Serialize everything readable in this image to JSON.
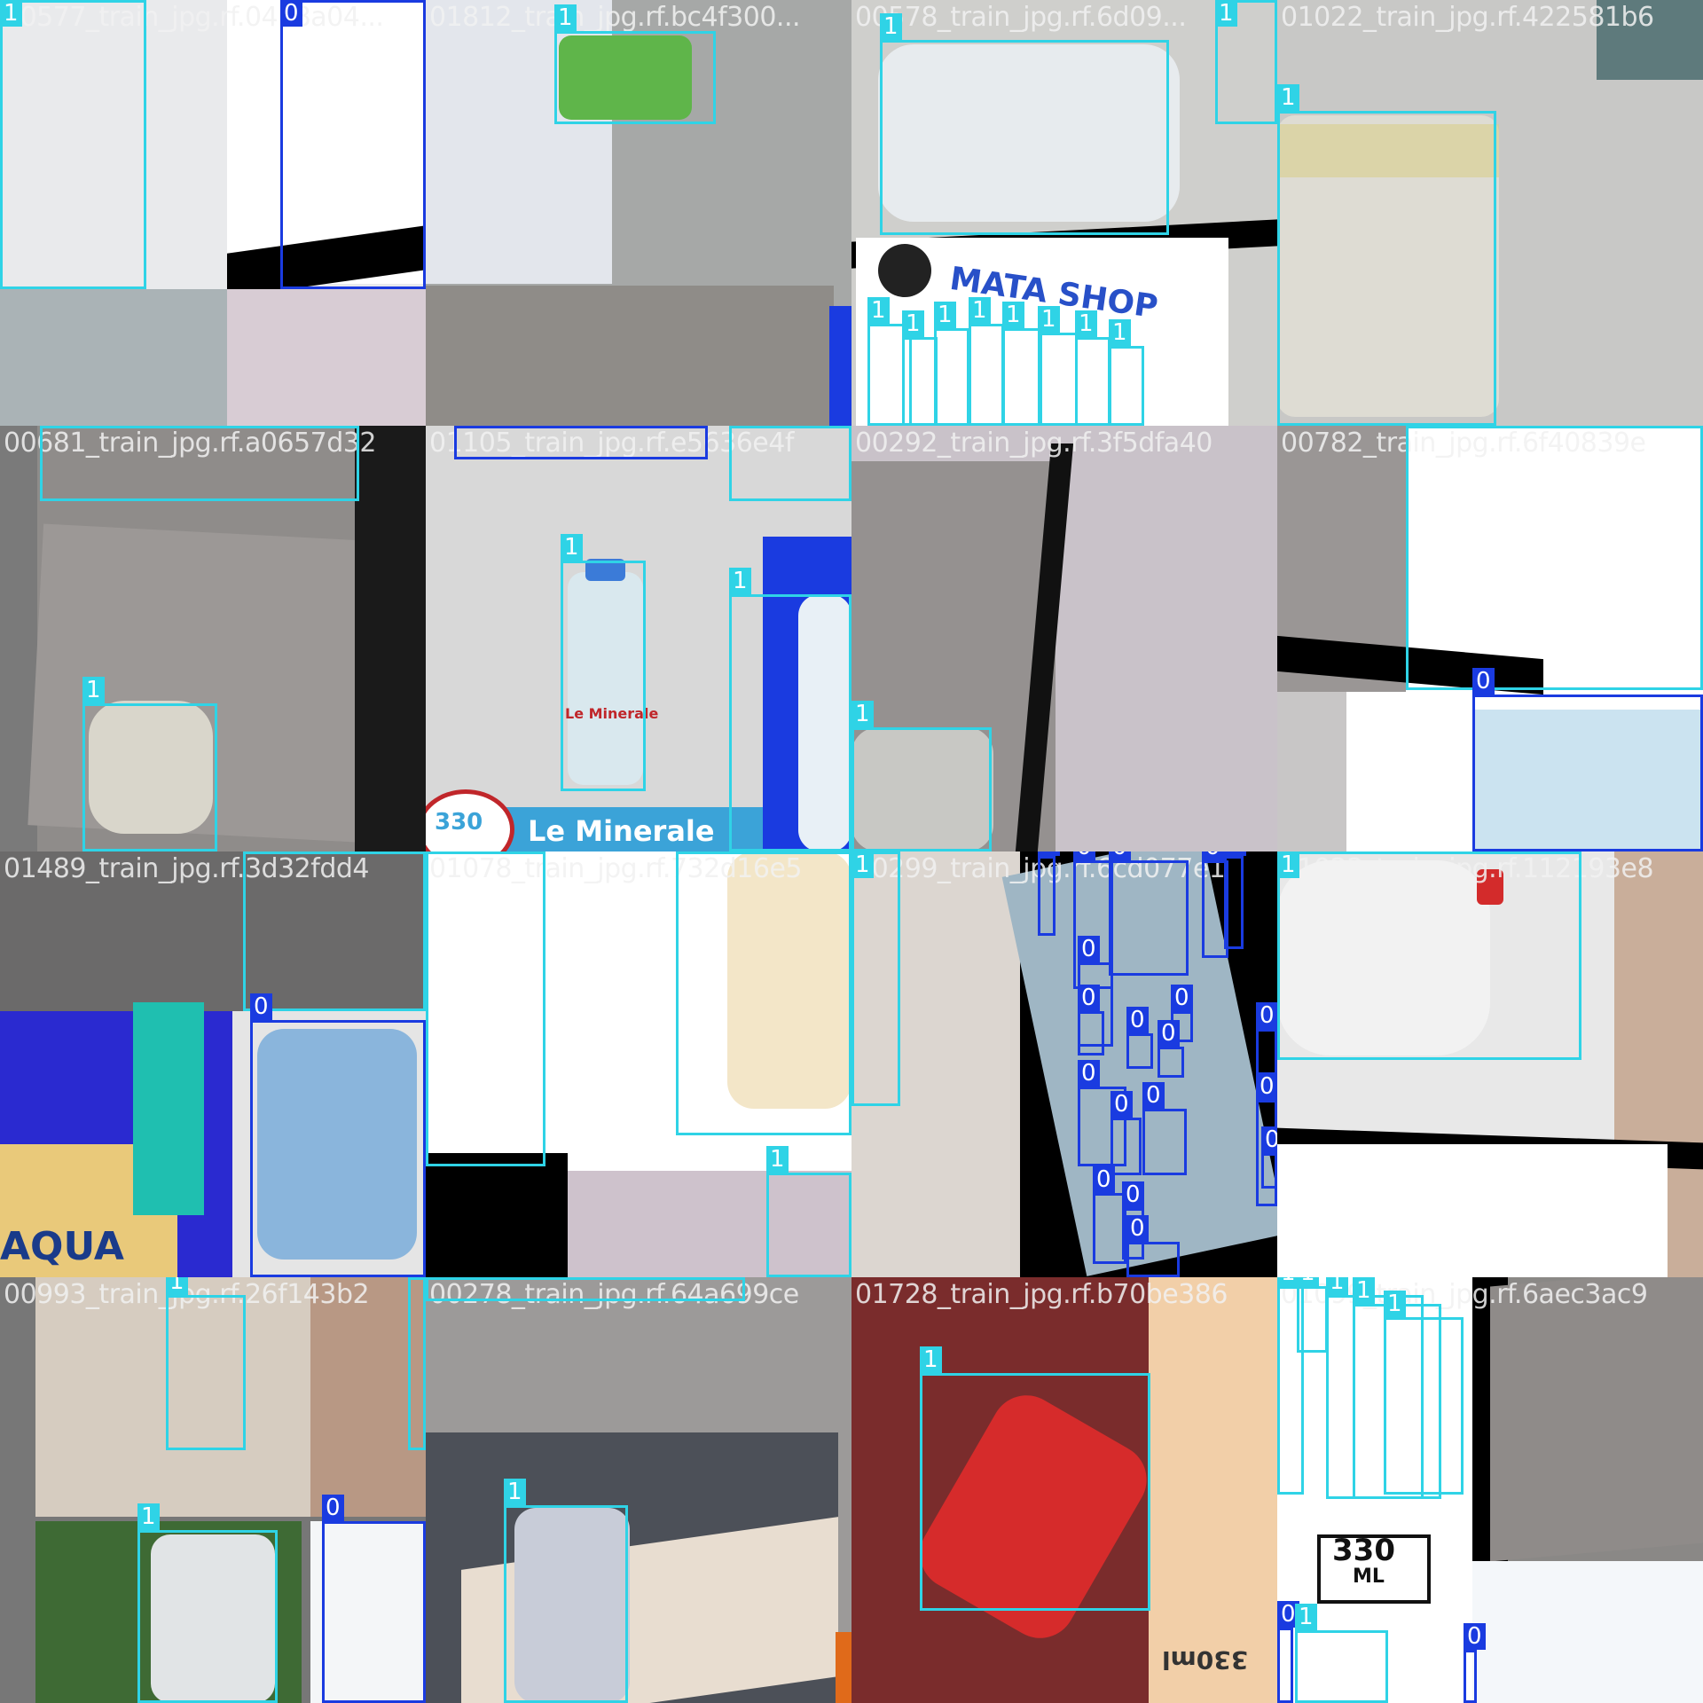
{
  "mosaic": {
    "tiles": [
      {
        "filename": "00577_train_jpg.rf.04b8a04...",
        "bg": "#e9eaec"
      },
      {
        "filename": "01812_train_jpg.rf.bc4f300...",
        "bg": "#a6a8a7"
      },
      {
        "filename": "00578_train_jpg.rf.6d09...",
        "bg": "#cfcfcc"
      },
      {
        "filename": "01022_train_jpg.rf.422581b6",
        "bg": "#c8c8c6"
      },
      {
        "filename": "00681_train_jpg.rf.a0657d32",
        "bg": "#8f8c8a"
      },
      {
        "filename": "01105_train_jpg.rf.e5636e4f",
        "bg": "#d8d8d8"
      },
      {
        "filename": "00292_train_jpg.rf.3f5dfa40",
        "bg": "#c9c2c9"
      },
      {
        "filename": "00782_train_jpg.rf.6f40839e",
        "bg": "#ffffff"
      },
      {
        "filename": "01489_train_jpg.rf.3d32fdd4",
        "bg": "#2a2ad0"
      },
      {
        "filename": "01078_train_jpg.rf.732d16e5",
        "bg": "#ffffff"
      },
      {
        "filename": "00299_train_jpg.rf.6cd077e1",
        "bg": "#dcd6d0"
      },
      {
        "filename": "01022_train_jpg.rf.112193e8",
        "bg": "#e8e8e8"
      },
      {
        "filename": "00993_train_jpg.rf.26f143b2",
        "bg": "#777777"
      },
      {
        "filename": "00278_train_jpg.rf.64a699ce",
        "bg": "#9c9a99"
      },
      {
        "filename": "01728_train_jpg.rf.b70be386",
        "bg": "#7a2c2c"
      },
      {
        "filename": "01099_train_jpg.rf.6aec3ac9",
        "bg": "#8a8886"
      }
    ],
    "class_labels": {
      "one": "1",
      "zero": "0"
    },
    "product_text": {
      "le_minerale": "Le Minerale",
      "ml_330": "330",
      "ml": "ML",
      "mata_shop": "MATA SHOP",
      "ml_330_mirrored": "330ml",
      "aqua": "AQUA"
    },
    "colors": {
      "class_1": "#2fd3e6",
      "class_0": "#1a3be0"
    }
  }
}
